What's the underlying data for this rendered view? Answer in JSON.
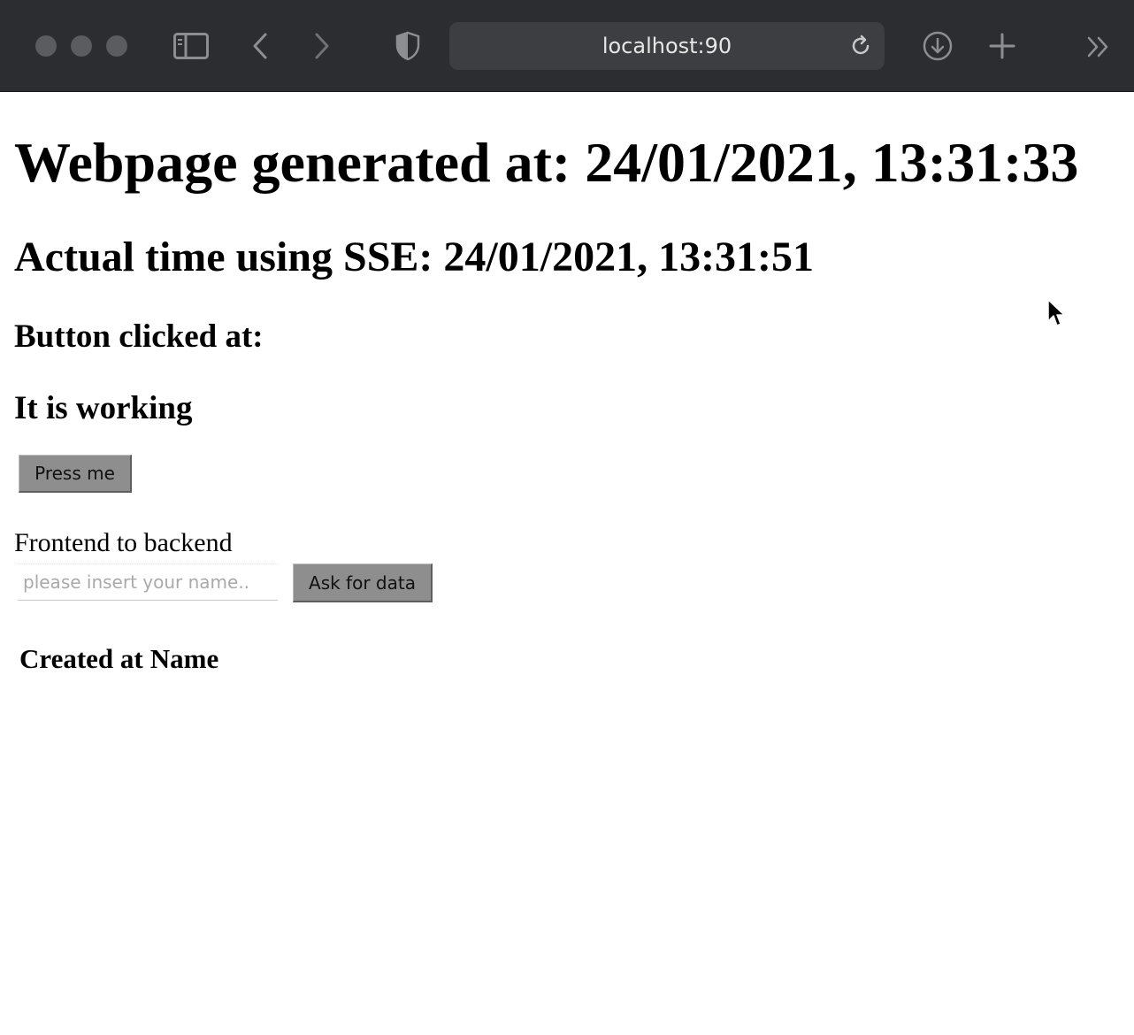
{
  "browser": {
    "url": "localhost:90",
    "icons": [
      "window-close-dot",
      "window-minimize-dot",
      "window-zoom-dot",
      "sidebar-icon",
      "back-icon",
      "forward-icon",
      "privacy-shield-icon",
      "reload-icon",
      "download-icon",
      "new-tab-icon",
      "overflow-chevrons-icon"
    ]
  },
  "page": {
    "generated_heading": "Webpage generated at: 24/01/2021, 13:31:33",
    "sse_heading": "Actual time using SSE: 24/01/2021, 13:31:51",
    "button_clicked_heading": "Button clicked at:",
    "status_heading": "It is working",
    "press_button_label": "Press me",
    "frontend_label": "Frontend to backend",
    "name_placeholder": "please insert your name..",
    "name_value": "",
    "ask_button_label": "Ask for data",
    "table_headers": [
      "Created at",
      "Name"
    ]
  },
  "colors": {
    "toolbar": "#2c2d30",
    "address_bar": "#3d3e41",
    "button_bg": "#8e8e8e"
  }
}
